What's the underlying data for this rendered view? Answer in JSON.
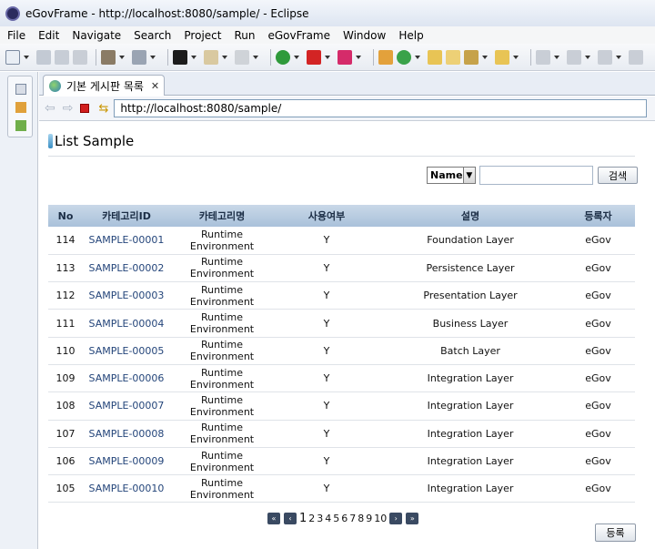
{
  "window": {
    "title": "eGovFrame - http://localhost:8080/sample/ - Eclipse"
  },
  "menu": [
    "File",
    "Edit",
    "Navigate",
    "Search",
    "Project",
    "Run",
    "eGovFrame",
    "Window",
    "Help"
  ],
  "editor": {
    "tab_title": "기본 게시판 목록",
    "url": "http://localhost:8080/sample/"
  },
  "page": {
    "title": "List Sample",
    "search": {
      "select_value": "Name",
      "input_value": "",
      "button_label": "검색"
    },
    "table": {
      "headers": [
        "No",
        "카테고리ID",
        "카테고리명",
        "사용여부",
        "설명",
        "등록자"
      ],
      "rows": [
        [
          "114",
          "SAMPLE-00001",
          "Runtime Environment",
          "Y",
          "Foundation Layer",
          "eGov"
        ],
        [
          "113",
          "SAMPLE-00002",
          "Runtime Environment",
          "Y",
          "Persistence Layer",
          "eGov"
        ],
        [
          "112",
          "SAMPLE-00003",
          "Runtime Environment",
          "Y",
          "Presentation Layer",
          "eGov"
        ],
        [
          "111",
          "SAMPLE-00004",
          "Runtime Environment",
          "Y",
          "Business Layer",
          "eGov"
        ],
        [
          "110",
          "SAMPLE-00005",
          "Runtime Environment",
          "Y",
          "Batch Layer",
          "eGov"
        ],
        [
          "109",
          "SAMPLE-00006",
          "Runtime Environment",
          "Y",
          "Integration Layer",
          "eGov"
        ],
        [
          "108",
          "SAMPLE-00007",
          "Runtime Environment",
          "Y",
          "Integration Layer",
          "eGov"
        ],
        [
          "107",
          "SAMPLE-00008",
          "Runtime Environment",
          "Y",
          "Integration Layer",
          "eGov"
        ],
        [
          "106",
          "SAMPLE-00009",
          "Runtime Environment",
          "Y",
          "Integration Layer",
          "eGov"
        ],
        [
          "105",
          "SAMPLE-00010",
          "Runtime Environment",
          "Y",
          "Integration Layer",
          "eGov"
        ]
      ]
    },
    "pagination": {
      "current": "1",
      "pages": [
        "1",
        "2",
        "3",
        "4",
        "5",
        "6",
        "7",
        "8",
        "9",
        "10"
      ]
    },
    "register_label": "등록"
  },
  "colors": {
    "header_bg": "#b9cde2",
    "link": "#24457a",
    "title_marker": "#3a8fc4"
  }
}
